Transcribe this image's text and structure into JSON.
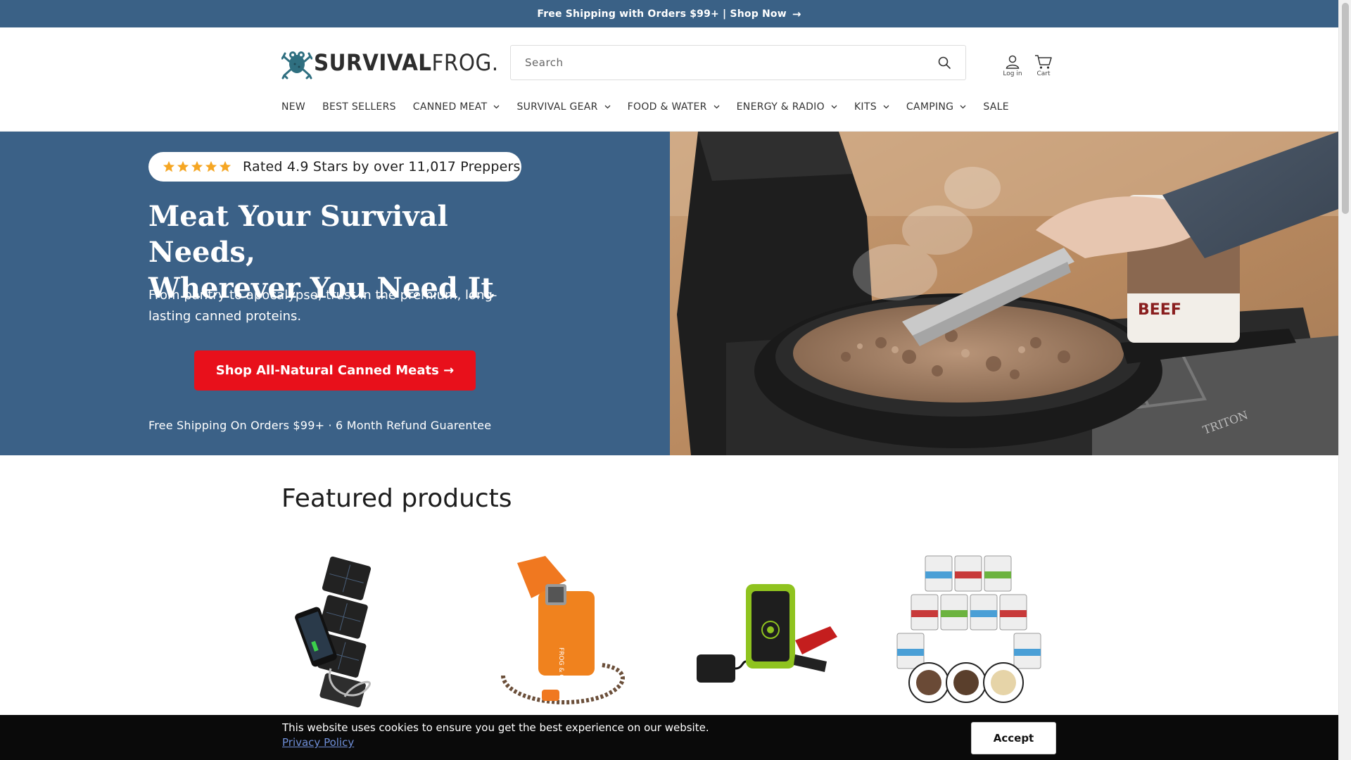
{
  "announcement": {
    "text": "Free Shipping with Orders $99+ | Shop Now",
    "arrow": "→"
  },
  "brand": {
    "name_bold": "SURVIVAL",
    "name_light": "FROG",
    "suffix": "."
  },
  "search": {
    "placeholder": "Search"
  },
  "header": {
    "login_label": "Log in",
    "cart_label": "Cart"
  },
  "nav": {
    "items": [
      {
        "label": "NEW",
        "dropdown": false
      },
      {
        "label": "BEST SELLERS",
        "dropdown": false
      },
      {
        "label": "CANNED MEAT",
        "dropdown": true
      },
      {
        "label": "SURVIVAL GEAR",
        "dropdown": true
      },
      {
        "label": "FOOD & WATER",
        "dropdown": true
      },
      {
        "label": "ENERGY & RADIO",
        "dropdown": true
      },
      {
        "label": "KITS",
        "dropdown": true
      },
      {
        "label": "CAMPING",
        "dropdown": true
      },
      {
        "label": "SALE",
        "dropdown": false
      }
    ]
  },
  "hero": {
    "rating_text": "Rated 4.9 Stars by over 11,017 Preppers",
    "star_count": 5,
    "headline_line1": "Meat Your Survival Needs,",
    "headline_line2": "Wherever You Need It",
    "subtext": "From pantry to apocalypse, trust in the premium, long-lasting canned proteins.",
    "cta_label": "Shop All-Natural Canned Meats →",
    "fine_print": "Free Shipping On Orders $99+ · 6 Month Refund Guarentee",
    "image_can_label": "BEEF",
    "image_stove_label": "TRITON"
  },
  "featured": {
    "title": "Featured products",
    "products": [
      {
        "name": "solar-charger-image"
      },
      {
        "name": "lighter-image"
      },
      {
        "name": "jump-starter-image"
      },
      {
        "name": "canned-meat-bundle-image"
      }
    ]
  },
  "cookie": {
    "message": "This website uses cookies to ensure you get the best experience on our website.",
    "link_text": "Privacy Policy",
    "accept_label": "Accept"
  },
  "colors": {
    "brand_blue": "#3b6187",
    "cta_red": "#e8101b",
    "star_gold": "#f5a623"
  }
}
